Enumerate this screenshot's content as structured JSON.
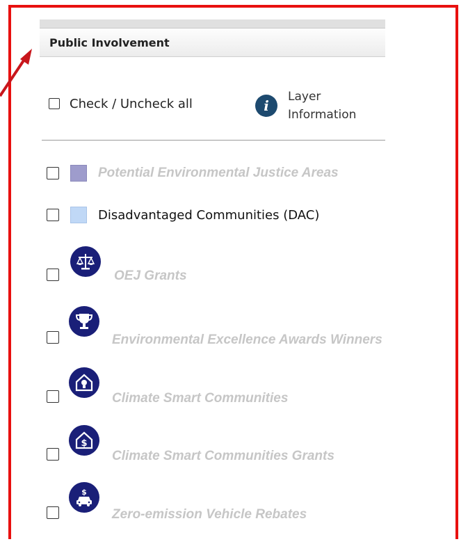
{
  "panel": {
    "section_title": "Public Involvement",
    "check_all_label": "Check / Uncheck all",
    "layer_info_label": "Layer Information"
  },
  "layers": [
    {
      "label": "Potential Environmental Justice Areas",
      "swatch_color": "#9e9ccc",
      "active": false,
      "icon": "swatch"
    },
    {
      "label": "Disadvantaged Communities (DAC)",
      "swatch_color": "#c0d8f6",
      "active": true,
      "icon": "swatch"
    },
    {
      "label": "OEJ Grants",
      "active": false,
      "icon": "scales-icon"
    },
    {
      "label": "Environmental Excellence Awards Winners",
      "active": false,
      "icon": "trophy-icon"
    },
    {
      "label": "Climate Smart Communities",
      "active": false,
      "icon": "house-lightbulb-icon"
    },
    {
      "label": "Climate Smart Communities Grants",
      "active": false,
      "icon": "house-dollar-icon"
    },
    {
      "label": "Zero-emission Vehicle Rebates",
      "active": false,
      "icon": "car-dollar-icon"
    }
  ],
  "colors": {
    "annotation_red": "#e8100f",
    "icon_navy": "#1a1f78",
    "info_blue": "#1d4a6f",
    "inactive_text": "#c6c6c6"
  }
}
